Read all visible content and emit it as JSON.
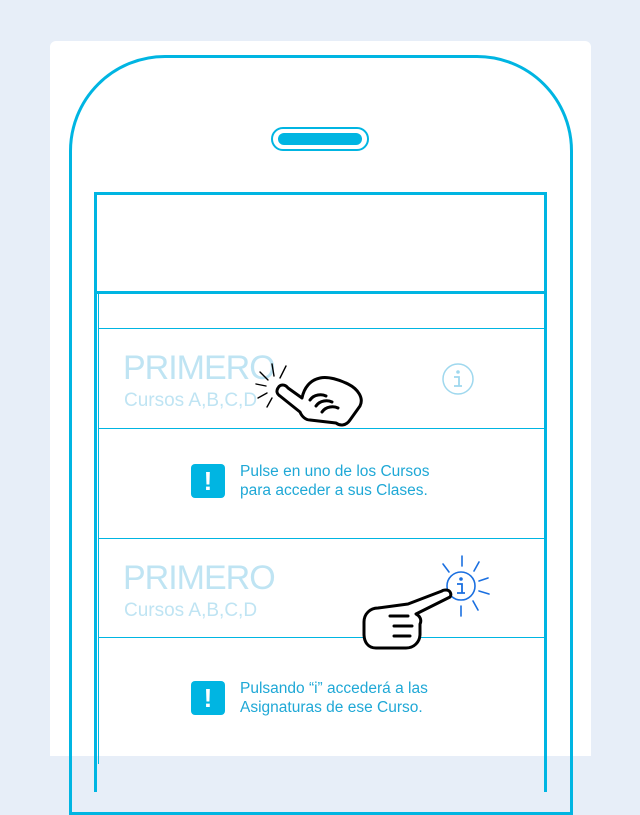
{
  "courses": [
    {
      "title": "PRIMERO",
      "subtitle": "Cursos A,B,C,D"
    },
    {
      "title": "PRIMERO",
      "subtitle": "Cursos A,B,C,D"
    }
  ],
  "notes": [
    {
      "line1": "Pulse en uno de los Cursos",
      "line2": "para acceder a sus Clases."
    },
    {
      "line1": "Pulsando “i” accederá a las",
      "line2": "Asignaturas de ese Curso."
    }
  ],
  "icons": {
    "info": "info-icon",
    "alert": "exclamation-icon",
    "hand": "pointing-hand-icon"
  },
  "colors": {
    "accent": "#00b5e2",
    "background": "#e7eef8",
    "faded_text": "#bfe4f3",
    "note_text": "#1fa8d6",
    "tap_blue": "#1a6fe0"
  }
}
